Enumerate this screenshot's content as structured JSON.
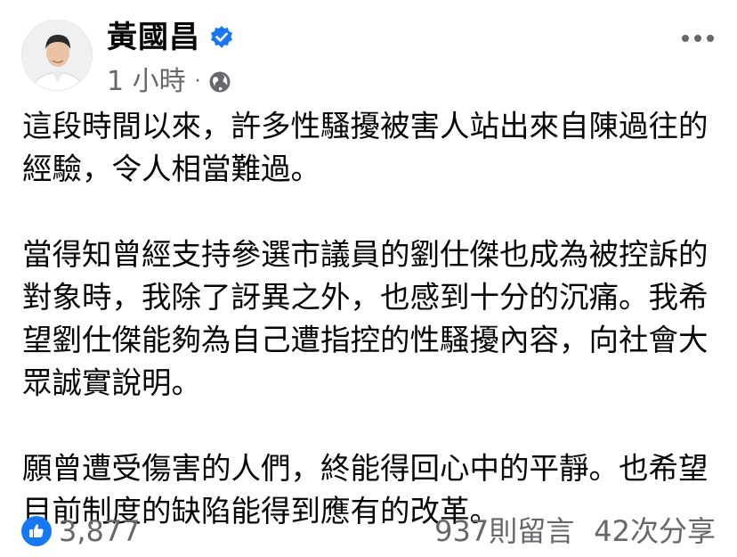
{
  "post": {
    "author": "黃國昌",
    "verified_icon": "verified-badge-icon",
    "time": "1 小時",
    "separator": "·",
    "privacy_icon": "globe-icon",
    "more_icon": "more-options-icon",
    "paragraphs": [
      "這段時間以來，許多性騷擾被害人站出來自陳過往的經驗，令人相當難過。",
      "當得知曾經支持參選市議員的劉仕傑也成為被控訴的對象時，我除了訝異之外，也感到十分的沉痛。我希望劉仕傑能夠為自己遭指控的性騷擾內容，向社會大眾誠實說明。",
      "願曾遭受傷害的人們，終能得回心中的平靜。也希望目前制度的缺陷能得到應有的改革。"
    ]
  },
  "reactions": {
    "icon": "like-thumb-icon",
    "count": "3,877",
    "comments": "937則留言",
    "shares": "42次分享"
  },
  "colors": {
    "accent": "#1877f2",
    "secondary_text": "#65676b",
    "primary_text": "#050505"
  }
}
